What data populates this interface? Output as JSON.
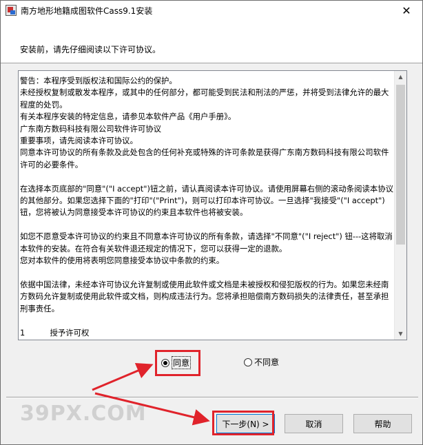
{
  "window": {
    "title": "南方地形地籍成图软件Cass9.1安装",
    "close_glyph": "✕"
  },
  "header": {
    "instruction": "安装前，请先仔细阅读以下许可协议。"
  },
  "license": {
    "text": "警告：本程序受到版权法和国际公约的保护。\n未经授权复制或散发本程序，或其中的任何部分，都可能受到民法和刑法的严惩，并将受到法律允许的最大程度的处罚。\n有关本程序安装的特定信息，请参见本软件产品《用户手册》。\n广东南方数码科技有限公司软件许可协议\n重要事项，请先阅读本许可协议。\n同意本许可协议的所有条款及此处包含的任何补充或特殊的许可条款是获得广东南方数码科技有限公司软件许可的必要条件。\n\n在选择本页底部的\"同意\"(\"I accept\")钮之前，请认真阅读本许可协议。请使用屏幕右侧的滚动条阅读本协议的其他部分。如果您选择下面的\"打印\"(\"Print\")，则可以打印本许可协议。一旦选择\"我接受\"(\"I accept\")钮，您将被认为同意接受本许可协议的约束且本软件也将被安装。\n\n如您不愿意受本许可协议的约束且不同意本许可协议的所有条款，请选择\"不同意\"(\"I reject\") 钮---这将取消本软件的安装。在符合有关软件退还规定的情况下，您可以获得一定的退款。\n您对本软件的使用将表明您同意接受本协议中条款的约束。\n\n依据中国法律，未经本许可协议允许复制或使用此软件或文档是未被授权和侵犯版权的行为。如果您未经南方数码允许复制或使用此软件或文档，则构成违法行为。您将承担赔偿南方数码损失的法律责任，甚至承担刑事责任。\n\n1          授予许可权"
  },
  "options": {
    "agree": "同意",
    "disagree": "不同意",
    "selected": "agree"
  },
  "buttons": {
    "next": "下一步(N) >",
    "cancel": "取消",
    "help": "帮助"
  },
  "watermark": "39PX.COM",
  "colors": {
    "highlight": "#e0232b",
    "default_button_border": "#0078d7"
  }
}
